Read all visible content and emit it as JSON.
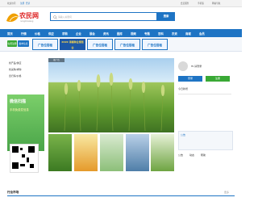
{
  "topbar": {
    "links_left": [
      "欢迎访问",
      "注册",
      "登录"
    ],
    "links_right": [
      "会员服务",
      "手机版",
      "网站导航"
    ]
  },
  "header": {
    "logo_text": "农民网",
    "logo_sub": "nongminwang",
    "search_placeholder": "请输入关键词",
    "search_button": "搜索"
  },
  "nav": {
    "items": [
      "首页",
      "行情",
      "价格",
      "供应",
      "求购",
      "企业",
      "展会",
      "资讯",
      "图库",
      "视频",
      "专题",
      "百科",
      "农资",
      "商城",
      "会员"
    ]
  },
  "subnav": {
    "btn_green": "免费注册",
    "btn_blue": "发布信息",
    "ads": [
      "广告位招租",
      "2020 海南种业博览会",
      "广告位招租",
      "广告位招租",
      "广告位招租"
    ]
  },
  "left": {
    "menu": [
      "找产品/供应",
      "找采购/求购",
      "查行情/价格"
    ],
    "banner_title": "微信扫描",
    "banner_sub": "手机免费发信息"
  },
  "hero": {
    "tag": "推广位",
    "dots": [
      "1",
      "2",
      "3",
      "4",
      "5"
    ]
  },
  "right": {
    "username": "HI,请登录",
    "login": "登录",
    "register": "注册",
    "stats_title": "今日新增",
    "notice": "公告",
    "tabs": [
      "公告",
      "动态",
      "帮助"
    ]
  },
  "footer": {
    "section_title": "行业市场",
    "more": "更多"
  },
  "colors": {
    "brand_blue": "#1e74c4",
    "brand_green": "#39a935",
    "logo_orange": "#f0a000"
  }
}
